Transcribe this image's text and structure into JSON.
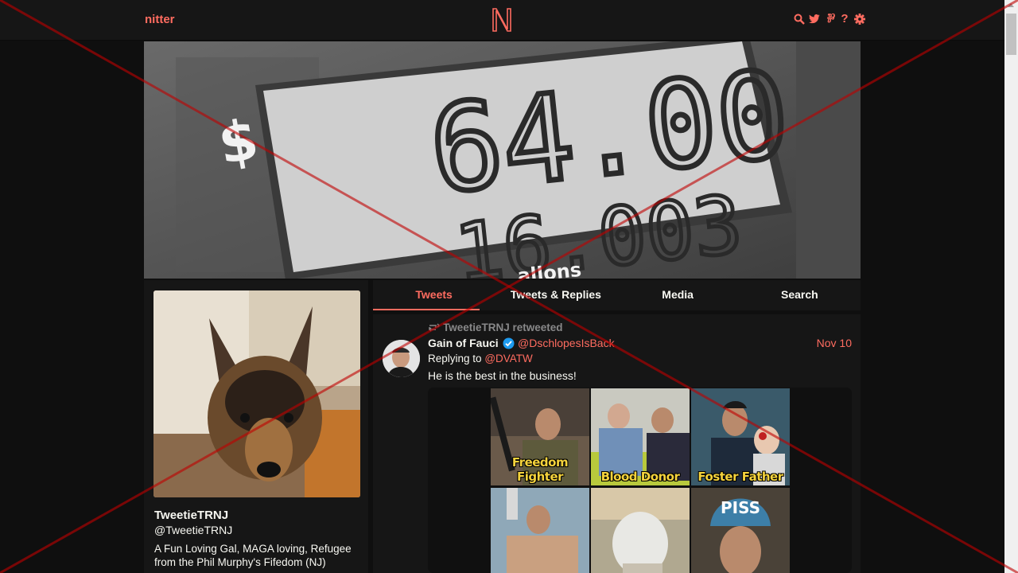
{
  "nav": {
    "brand": "nitter",
    "logo_letter": "N",
    "icons": [
      "search-icon",
      "twitter-bird-icon",
      "rss-feed-icon",
      "help-icon",
      "gear-icon"
    ],
    "rss_glyph": "⅌",
    "help_glyph": "?"
  },
  "banner": {
    "price_top": "64.00",
    "price_bottom": "16.003",
    "dollar": "$",
    "unit": "allons"
  },
  "profile": {
    "name": "TweetieTRNJ",
    "handle": "@TweetieTRNJ",
    "bio": "A Fun Loving Gal, MAGA loving, Refugee from the Phil Murphy's Fifedom (NJ)"
  },
  "tabs": [
    {
      "label": "Tweets",
      "active": true
    },
    {
      "label": "Tweets & Replies",
      "active": false
    },
    {
      "label": "Media",
      "active": false
    },
    {
      "label": "Search",
      "active": false
    }
  ],
  "tweet": {
    "retweet_label": "TweetieTRNJ retweeted",
    "author_name": "Gain of Fauci",
    "author_handle": "@DschlopesIsBack",
    "date": "Nov 10",
    "replying_prefix": "Replying to",
    "replying_to": "@DVATW",
    "text": "He is the best in the business!",
    "media_captions": [
      "Freedom Fighter",
      "Blood Donor",
      "Foster Father",
      "",
      "",
      ""
    ],
    "press_helmet_text": "PISS"
  },
  "colors": {
    "accent": "#ff6c60",
    "background": "#0f0f0f",
    "panel": "#161616",
    "muted": "#888889",
    "verified": "#1d9bf0",
    "overlay": "#c00000"
  }
}
